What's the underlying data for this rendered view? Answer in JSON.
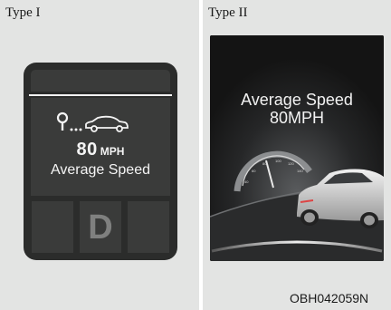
{
  "type_one": {
    "label": "Type I",
    "speed_value": "80",
    "speed_unit": "MPH",
    "caption": "Average Speed",
    "gear": "D"
  },
  "type_two": {
    "label": "Type II",
    "title_line1": "Average Speed",
    "title_line2": "80MPH",
    "gauge_ticks": [
      "40",
      "60",
      "80",
      "100",
      "120",
      "140"
    ]
  },
  "figure_code": "OBH042059N",
  "icons": [
    "location-pin-icon",
    "car-icon",
    "gauge-icon",
    "car-photo"
  ],
  "colors": {
    "panel_bg": "#e3e4e3",
    "cluster_bg": "#2b2c2b",
    "screen_bg": "#3a3b3a",
    "text_light": "#f4f4f4",
    "dark_display": "#1a1a1a"
  }
}
